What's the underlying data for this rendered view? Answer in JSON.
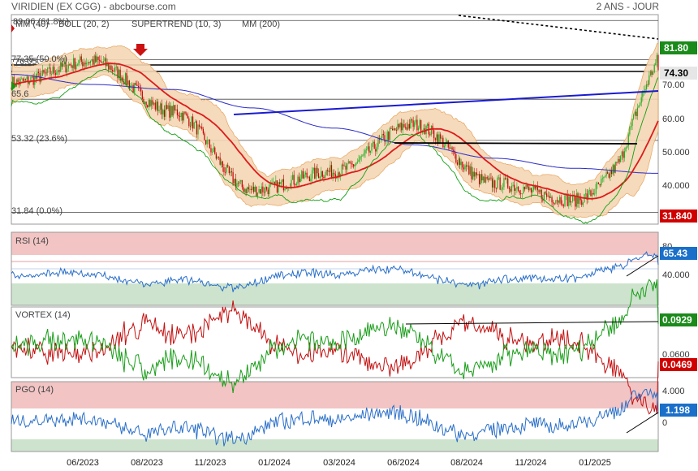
{
  "header": {
    "title": "VIRIDIEN (EX CGG) - abcbourse.com",
    "period": "2 ANS - JOUR"
  },
  "colors": {
    "candle_up": "#1fae1f",
    "candle_down": "#c40000",
    "mm40": "#dd1a1a",
    "boll": "#e59a4a",
    "boll_fill": "#f5d7b5",
    "supertrend": "#12a012",
    "mm200": "#2b2bc8",
    "rsi": "#2a6fc9",
    "vi_plus": "#1a9e1a",
    "vi_minus": "#c41010",
    "pgo": "#2a6fc9",
    "overbought": "#f2c4c4",
    "oversold": "#cde3cd",
    "price_badge": "#1a8a1a",
    "low_badge": "#d00000"
  },
  "price_panel": {
    "legend": [
      {
        "text": "MM (40)",
        "color": "#dd1a1a"
      },
      {
        "text": "BOLL (20, 2)",
        "color": "#e59a4a"
      },
      {
        "text": "SUPERTREND (10, 3)",
        "color": "#dd1a1a"
      },
      {
        "text": "MM (200)",
        "color": "#2b2bc8"
      }
    ],
    "fib_levels": [
      {
        "label": "89.06 (61.8%)",
        "value": 89.06
      },
      {
        "label": "77.35 (50.0%)",
        "value": 77.35
      },
      {
        "label": "65.6",
        "value": 65.6
      },
      {
        "label": "53.32 (23.6%)",
        "value": 53.32
      },
      {
        "label": "31.84 (0.0%)",
        "value": 31.84
      }
    ],
    "resistance_label": "76.05",
    "y_ticks": [
      "70.00",
      "60.00",
      "50.000",
      "40.000"
    ],
    "badges": {
      "high": "81.80",
      "last": "74.30",
      "low": "31.840"
    }
  },
  "rsi_panel": {
    "title": "RSI (14)",
    "ticks": [
      "80",
      "40.000"
    ],
    "value": "65.43"
  },
  "vortex_panel": {
    "title": "VORTEX (14)",
    "tick": "0.0600",
    "vi_plus": "0.0929",
    "vi_minus": "0.0469"
  },
  "pgo_panel": {
    "title": "PGO (14)",
    "ticks": [
      "4.000",
      "0"
    ],
    "value": "1.198"
  },
  "x_labels": [
    "06/2023",
    "08/2023",
    "11/2023",
    "01/2024",
    "03/2024",
    "06/2024",
    "08/2024",
    "11/2024",
    "01/2025"
  ],
  "chart_data": {
    "type": "line",
    "title": "VIRIDIEN (EX CGG) - abcbourse.com",
    "timeframe": "2 ANS - JOUR",
    "x": [
      "06/2023",
      "08/2023",
      "11/2023",
      "01/2024",
      "03/2024",
      "06/2024",
      "08/2024",
      "11/2024",
      "01/2025"
    ],
    "y_range": [
      31.84,
      81.8
    ],
    "series": [
      {
        "name": "close",
        "values": [
          70.5,
          77.0,
          62.0,
          38.5,
          44.0,
          58.0,
          40.5,
          35.5,
          56.0
        ]
      },
      {
        "name": "MM (40)",
        "values": [
          68.5,
          71.0,
          64.0,
          42.0,
          43.0,
          51.0,
          47.0,
          37.0,
          51.0
        ]
      },
      {
        "name": "MM (200)",
        "values": [
          73.0,
          70.0,
          68.5,
          63.0,
          57.0,
          52.0,
          48.0,
          45.0,
          43.5
        ]
      }
    ],
    "indicators": {
      "RSI (14)": 65.43,
      "VORTEX (14)": {
        "vi_plus": 0.0929,
        "vi_minus": 0.0469
      },
      "PGO (14)": 1.198
    }
  }
}
